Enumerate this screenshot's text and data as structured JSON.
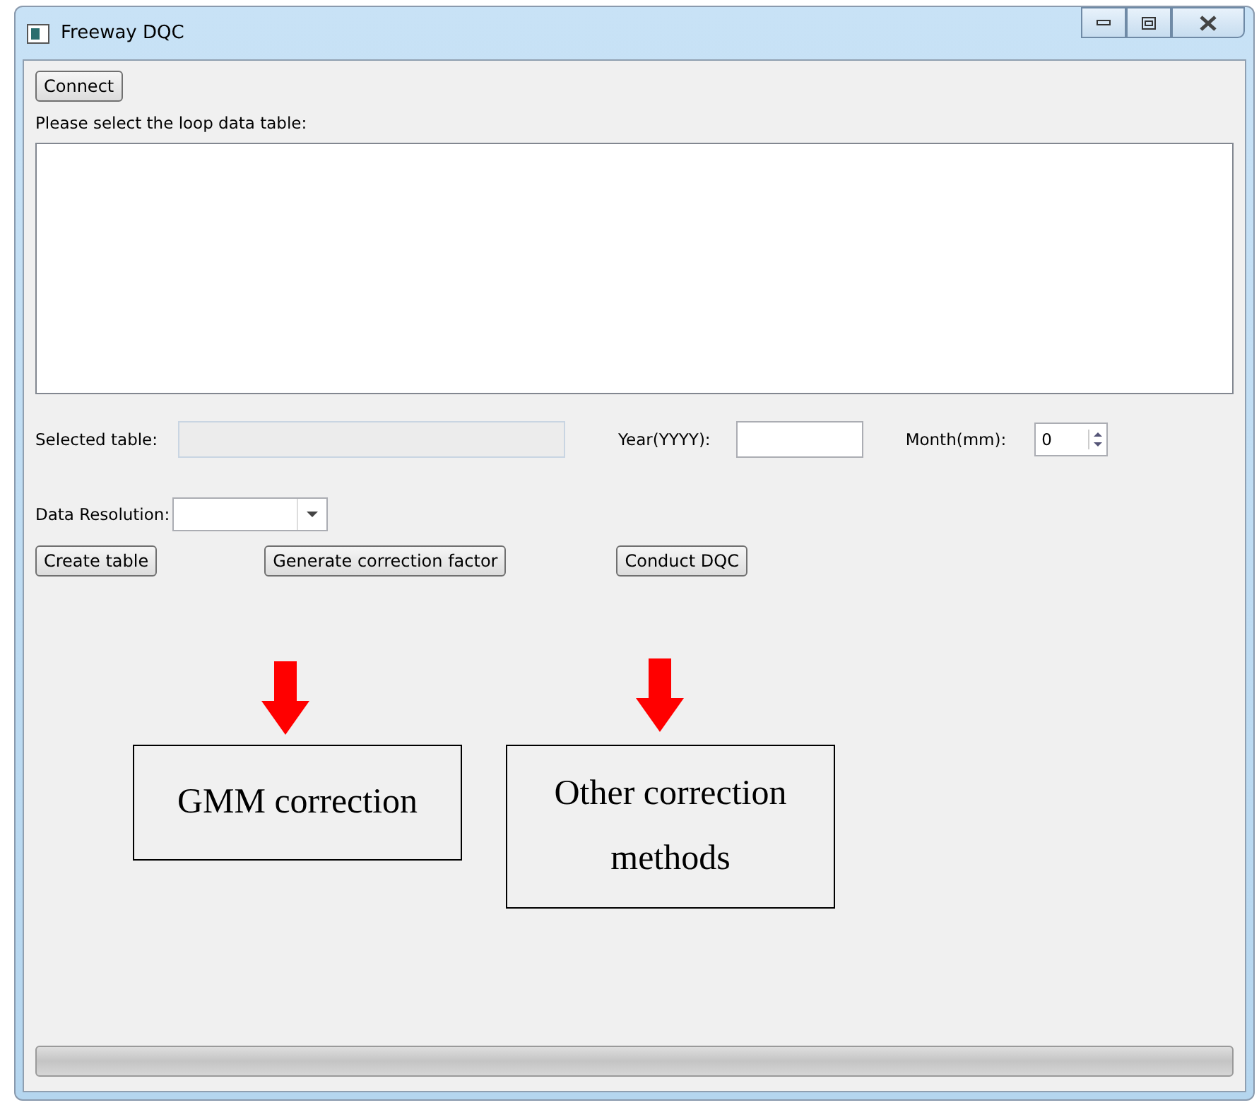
{
  "window": {
    "title": "Freeway DQC"
  },
  "connect_button": "Connect",
  "table_prompt": "Please select the loop data table:",
  "selected_table": {
    "label": "Selected table:"
  },
  "year": {
    "label": "Year(YYYY):"
  },
  "month": {
    "label": "Month(mm):",
    "value": "0"
  },
  "data_resolution": {
    "label": "Data Resolution:"
  },
  "buttons": [
    "Create table",
    "Generate correction factor",
    "Conduct DQC"
  ],
  "annotations": [
    {
      "text": "GMM correction"
    },
    {
      "text": "Other correction methods"
    }
  ],
  "progress": {
    "level": 0
  }
}
